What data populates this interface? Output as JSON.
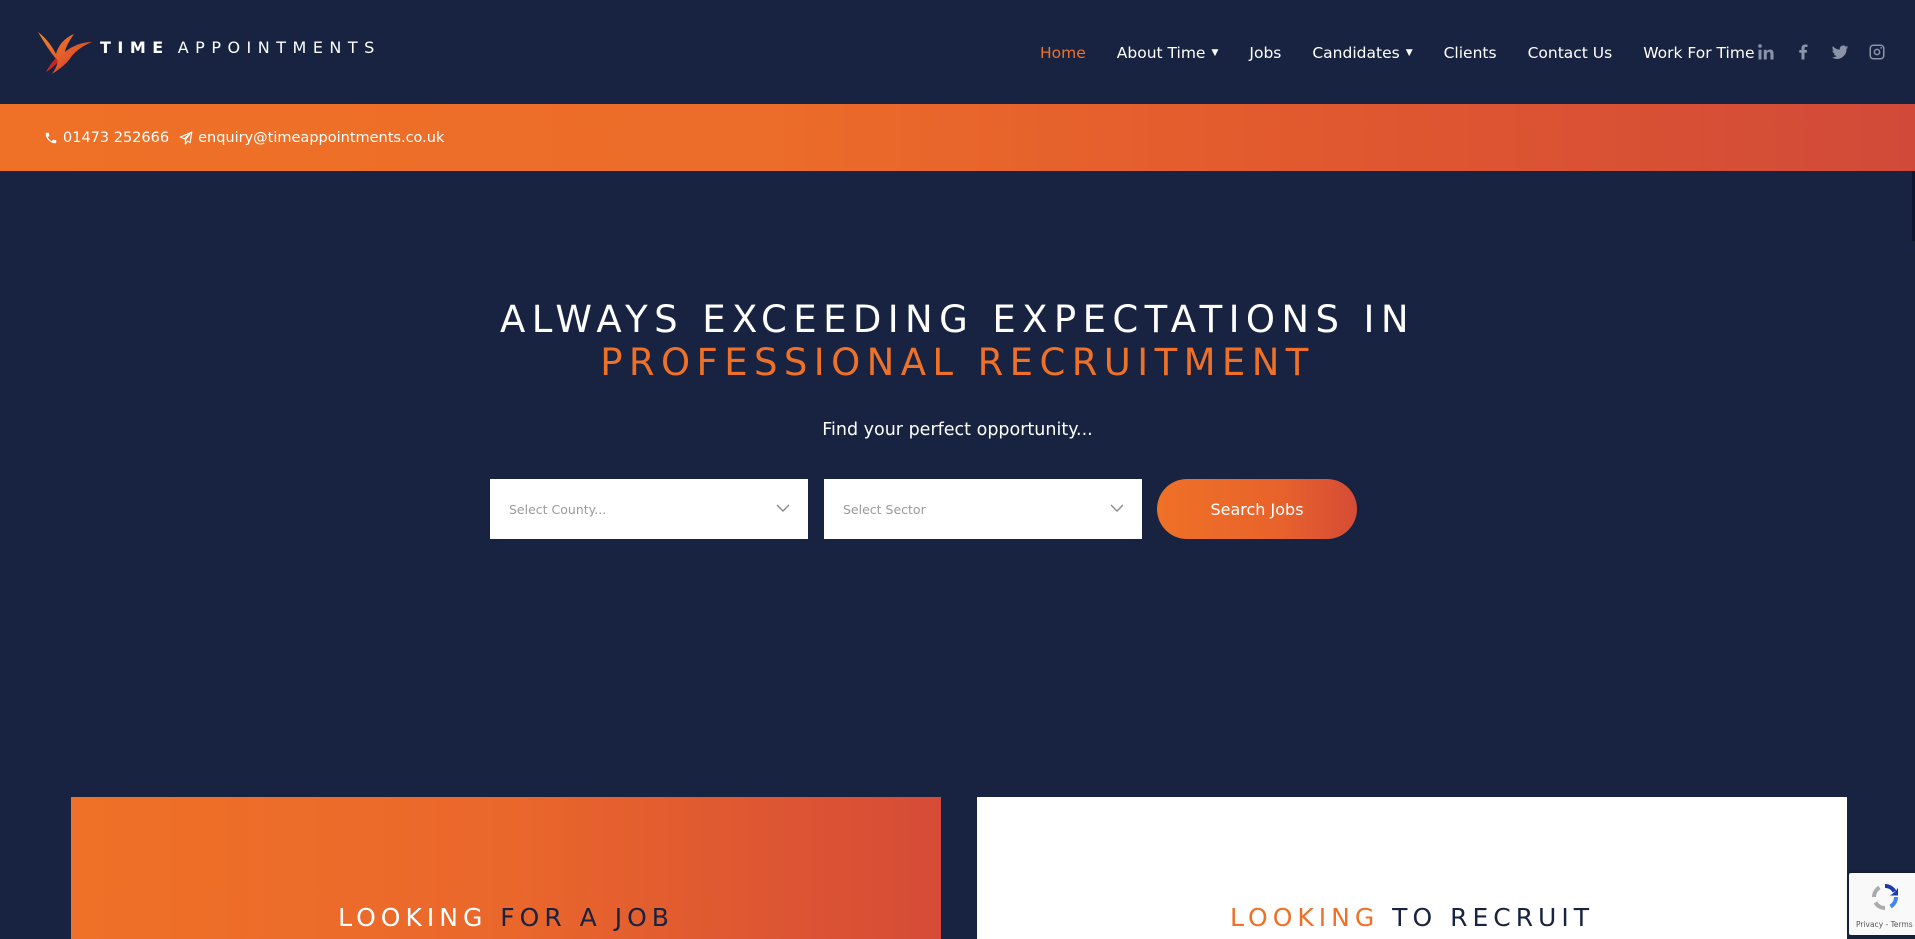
{
  "brand": {
    "name_bold": "TIME",
    "name_light": "APPOINTMENTS"
  },
  "nav": {
    "items": [
      {
        "label": "Home",
        "active": true,
        "dropdown": false
      },
      {
        "label": "About Time",
        "active": false,
        "dropdown": true
      },
      {
        "label": "Jobs",
        "active": false,
        "dropdown": false
      },
      {
        "label": "Candidates",
        "active": false,
        "dropdown": true
      },
      {
        "label": "Clients",
        "active": false,
        "dropdown": false
      },
      {
        "label": "Contact Us",
        "active": false,
        "dropdown": false
      },
      {
        "label": "Work For Time",
        "active": false,
        "dropdown": false
      }
    ],
    "socials": [
      "linkedin-icon",
      "facebook-icon",
      "twitter-icon",
      "instagram-icon"
    ]
  },
  "contact": {
    "phone": "01473 252666",
    "email": "enquiry@timeappointments.co.uk"
  },
  "hero": {
    "title_line1": "ALWAYS EXCEEDING EXPECTATIONS IN",
    "title_line2": "PROFESSIONAL RECRUITMENT",
    "subtitle": "Find your perfect opportunity...",
    "county_placeholder": "Select County...",
    "sector_placeholder": "Select Sector",
    "search_label": "Search Jobs"
  },
  "cards": {
    "left": {
      "word1": "LOOKING",
      "word2": "FOR A JOB"
    },
    "right": {
      "word1": "LOOKING",
      "word2": "TO RECRUIT"
    }
  },
  "recaptcha": {
    "footer": "Privacy - Terms"
  },
  "colors": {
    "navy": "#172340",
    "orange": "#ef7127",
    "red": "#d14a39"
  }
}
